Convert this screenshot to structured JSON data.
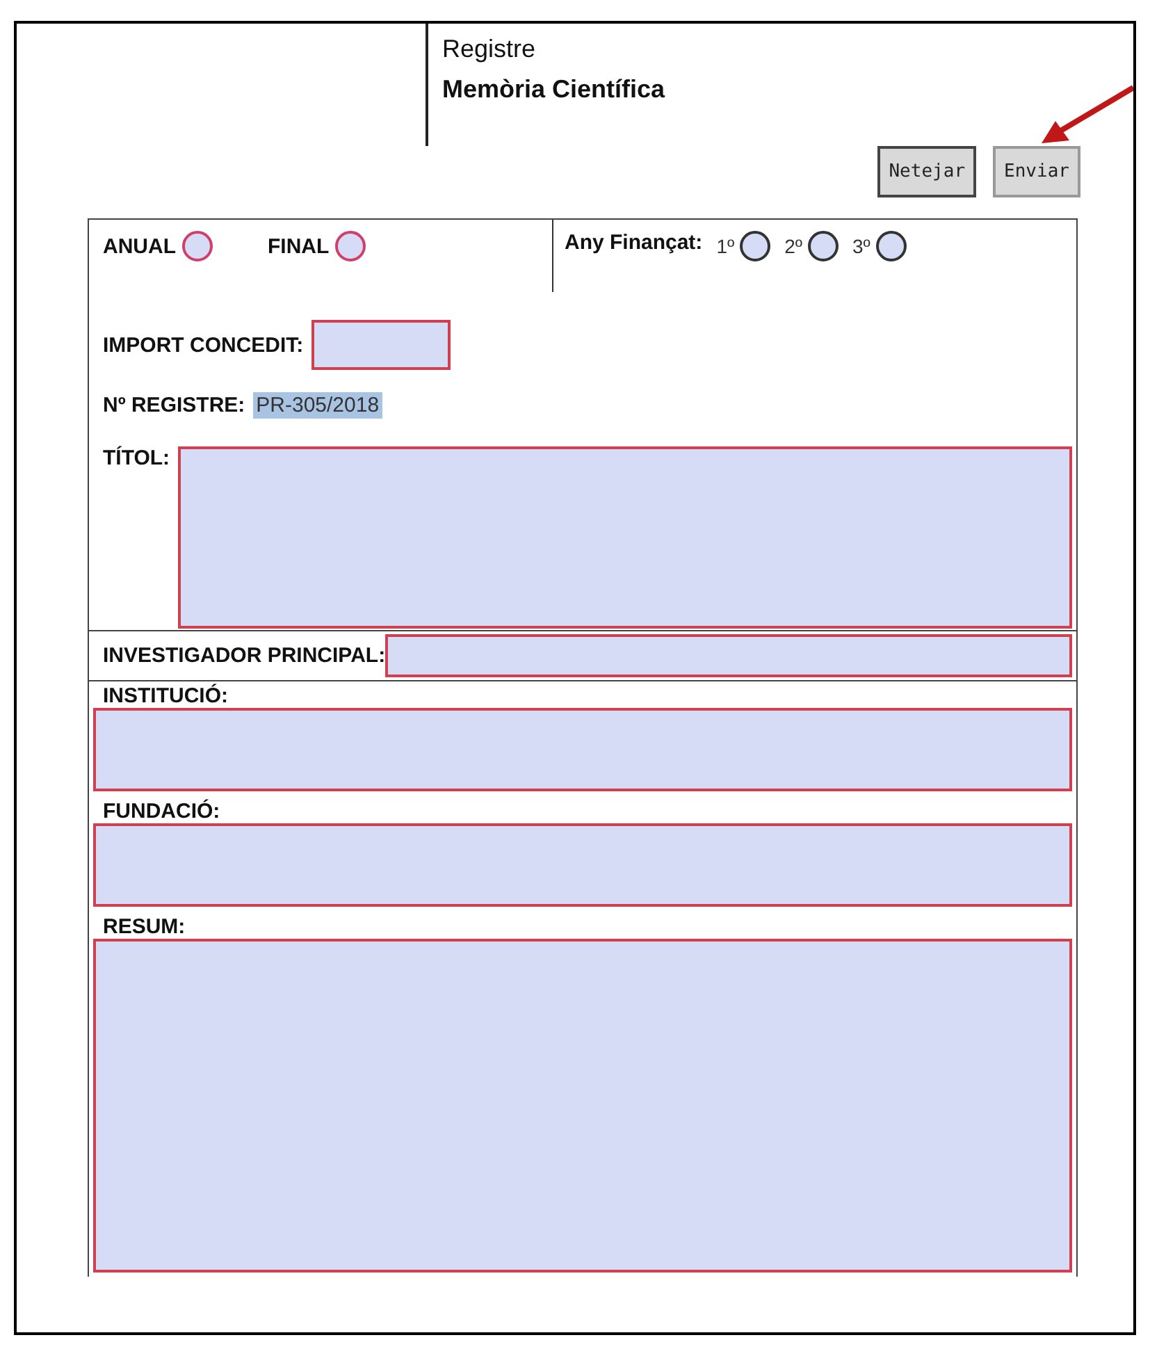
{
  "header": {
    "title": "Registre",
    "subtitle": "Memòria Científica"
  },
  "buttons": [
    {
      "label": "Netejar"
    },
    {
      "label": "Enviar"
    }
  ],
  "type_options": [
    {
      "label": "ANUAL",
      "selected": false
    },
    {
      "label": "FINAL",
      "selected": false
    }
  ],
  "year": {
    "label": "Any Finançat:",
    "options": [
      {
        "label": "1º",
        "selected": false
      },
      {
        "label": "2º",
        "selected": false
      },
      {
        "label": "3º",
        "selected": false
      }
    ]
  },
  "import": {
    "label": "IMPORT CONCEDIT:"
  },
  "registre": {
    "label": "Nº REGISTRE:",
    "value": "PR-305/2018"
  },
  "fields": [
    {
      "label": "TÍTOL:",
      "kind": "side"
    },
    {
      "label": "INVESTIGADOR PRINCIPAL:",
      "kind": "inline"
    },
    {
      "label": "INSTITUCIÓ:",
      "kind": "stacked"
    },
    {
      "label": "FUNDACIÓ:",
      "kind": "stacked"
    },
    {
      "label": "RESUM:",
      "kind": "tall"
    }
  ]
}
